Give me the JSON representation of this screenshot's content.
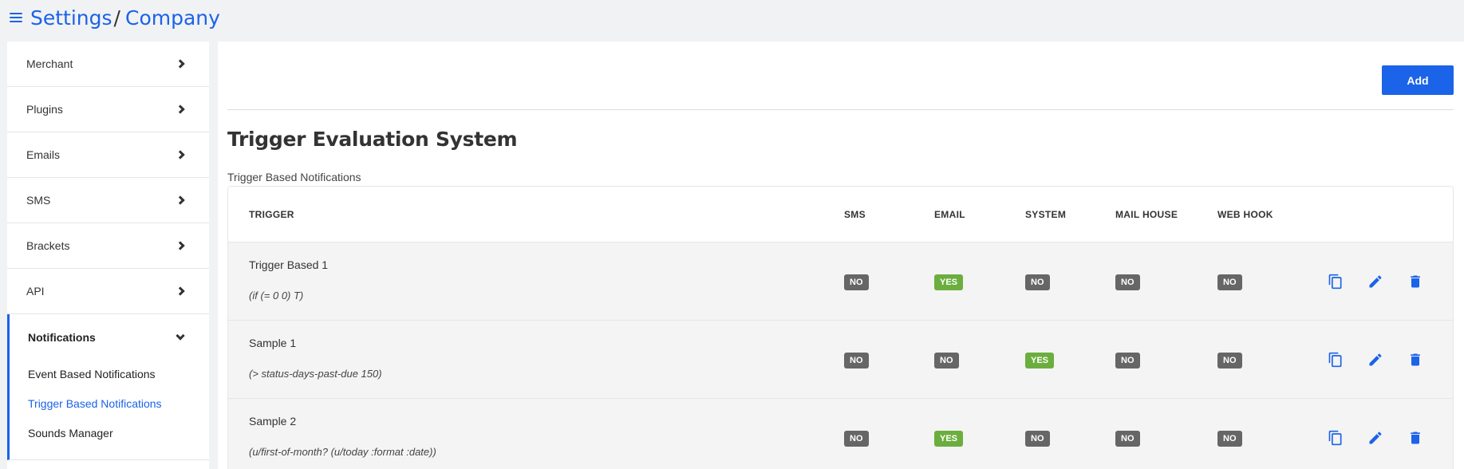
{
  "header": {
    "crumbs": [
      "Settings",
      "Company"
    ],
    "separator": "/"
  },
  "sidebar": {
    "items": [
      {
        "label": "Merchant"
      },
      {
        "label": "Plugins"
      },
      {
        "label": "Emails"
      },
      {
        "label": "SMS"
      },
      {
        "label": "Brackets"
      },
      {
        "label": "API"
      }
    ],
    "notifications": {
      "label": "Notifications",
      "sub_items": [
        {
          "label": "Event Based Notifications",
          "active": false
        },
        {
          "label": "Trigger Based Notifications",
          "active": true
        },
        {
          "label": "Sounds Manager",
          "active": false
        }
      ]
    }
  },
  "main": {
    "add_label": "Add",
    "title": "Trigger Evaluation System",
    "section_label": "Trigger Based Notifications",
    "table": {
      "headers": [
        "TRIGGER",
        "SMS",
        "EMAIL",
        "SYSTEM",
        "MAIL HOUSE",
        "WEB HOOK"
      ],
      "rows": [
        {
          "name": "Trigger Based 1",
          "expr": "(if (= 0 0) T)",
          "sms": "NO",
          "email": "YES",
          "system": "NO",
          "mail_house": "NO",
          "web_hook": "NO"
        },
        {
          "name": "Sample 1",
          "expr": "(> status-days-past-due 150)",
          "sms": "NO",
          "email": "NO",
          "system": "YES",
          "mail_house": "NO",
          "web_hook": "NO"
        },
        {
          "name": "Sample 2",
          "expr": "(u/first-of-month? (u/today :format :date))",
          "sms": "NO",
          "email": "YES",
          "system": "NO",
          "mail_house": "NO",
          "web_hook": "NO"
        }
      ]
    }
  },
  "colors": {
    "accent": "#1b63e8",
    "badge_yes": "#6cae3e",
    "badge_no": "#666666"
  },
  "icons": [
    "menu-icon",
    "chevron-right-icon",
    "chevron-down-icon",
    "copy-icon",
    "edit-icon",
    "delete-icon"
  ]
}
